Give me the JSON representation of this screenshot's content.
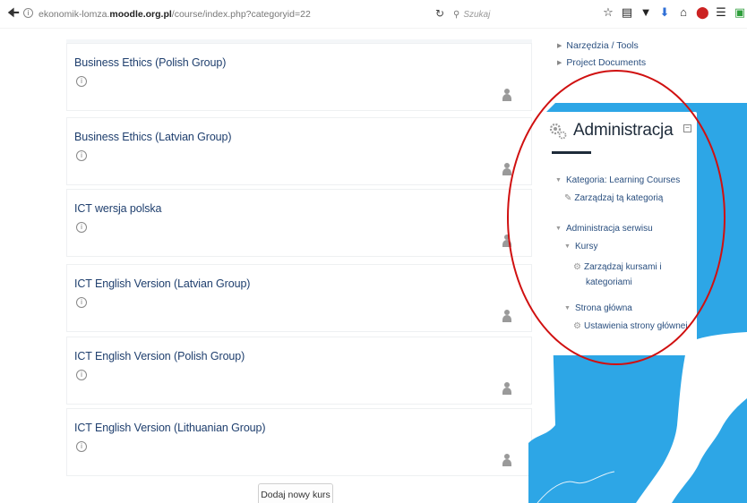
{
  "browser": {
    "url_prefix": "ekonomik-lomza.",
    "url_domain": "moodle.org.pl",
    "url_path": "/course/index.php?categoryid=22",
    "search_placeholder": "Szukaj",
    "icons": [
      "back-arrow-icon",
      "info-icon",
      "reload-icon",
      "search-icon",
      "bookmark-star-icon",
      "reading-list-icon",
      "pocket-icon",
      "download-icon",
      "home-icon",
      "adblock-icon",
      "menu-icon",
      "extension-icon"
    ]
  },
  "courses": [
    {
      "title": "Business Ethics (Polish Group)"
    },
    {
      "title": "Business Ethics (Latvian Group)"
    },
    {
      "title": "ICT wersja polska"
    },
    {
      "title": "ICT English Version (Latvian Group)"
    },
    {
      "title": "ICT English Version (Polish Group)"
    },
    {
      "title": "ICT English Version (Lithuanian Group)"
    }
  ],
  "add_course_label": "Dodaj nowy kurs",
  "nav_links": [
    {
      "label": "Narzędzia / Tools"
    },
    {
      "label": "Project Documents"
    }
  ],
  "admin": {
    "title": "Administracja",
    "category_label": "Kategoria: Learning Courses",
    "manage_category": "Zarządzaj tą kategorią",
    "site_admin": "Administracja serwisu",
    "courses": "Kursy",
    "manage_courses_line1": "Zarządzaj kursami i",
    "manage_courses_line2": "kategoriami",
    "front_page": "Strona główna",
    "front_page_settings": "Ustawienia strony głównej"
  },
  "colors": {
    "map_blue": "#2da6e6",
    "annotation_red": "#d01010",
    "link_blue": "#2a4f7f"
  }
}
